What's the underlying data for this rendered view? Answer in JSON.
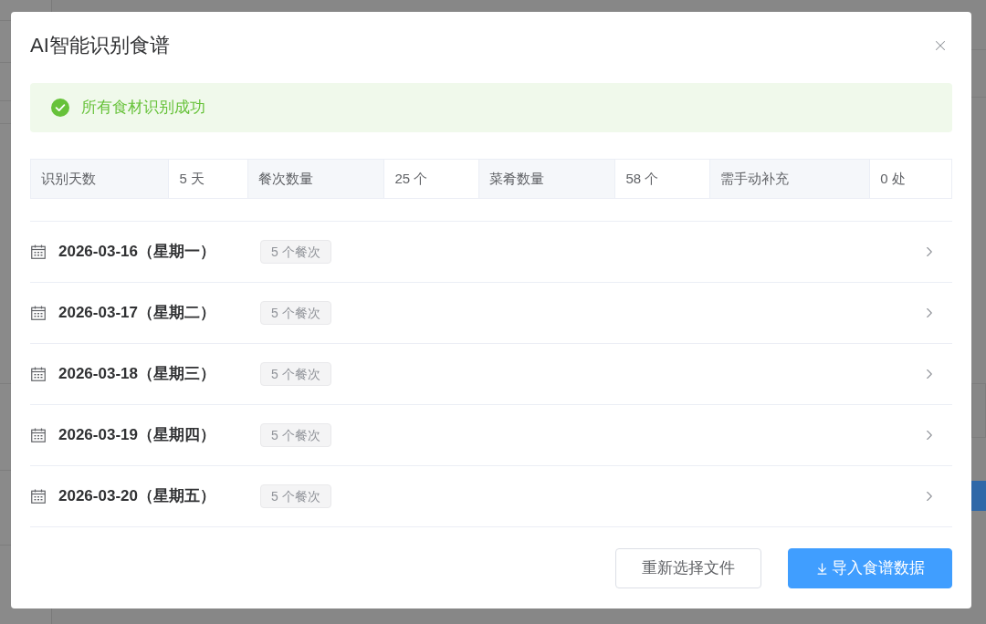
{
  "dialog": {
    "title": "AI智能识别食谱",
    "alert": {
      "kind": "success",
      "message": "所有食材识别成功"
    },
    "summary": [
      {
        "label": "识别天数",
        "value": "5 天"
      },
      {
        "label": "餐次数量",
        "value": "25 个"
      },
      {
        "label": "菜肴数量",
        "value": "58 个"
      },
      {
        "label": "需手动补充",
        "value": "0 处"
      }
    ],
    "days": [
      {
        "date": "2026-03-16（星期一）",
        "tag": "5 个餐次",
        "expanded": false
      },
      {
        "date": "2026-03-17（星期二）",
        "tag": "5 个餐次",
        "expanded": false
      },
      {
        "date": "2026-03-18（星期三）",
        "tag": "5 个餐次",
        "expanded": false
      },
      {
        "date": "2026-03-19（星期四）",
        "tag": "5 个餐次",
        "expanded": false
      },
      {
        "date": "2026-03-20（星期五）",
        "tag": "5 个餐次",
        "expanded": false
      }
    ],
    "buttons": [
      {
        "label": "重新选择文件",
        "kind": "default"
      },
      {
        "label": "导入食谱数据",
        "kind": "primary"
      }
    ]
  }
}
